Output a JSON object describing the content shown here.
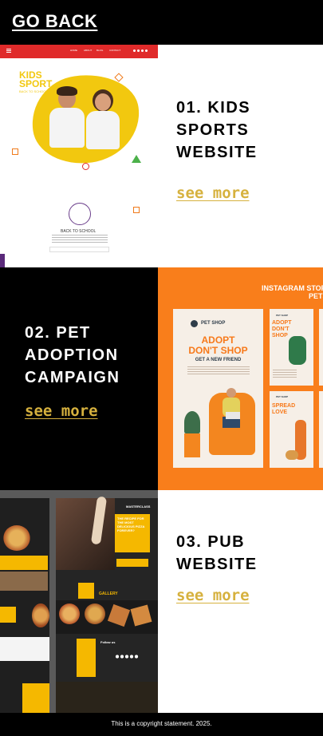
{
  "header": {
    "go_back_label": "GO BACK"
  },
  "projects": [
    {
      "title_line1": "01. KIDS",
      "title_line2": "SPORTS",
      "title_line3": "WEBSITE",
      "see_more_label": "see more",
      "thumbnail": {
        "logo_line1": "KIDS",
        "logo_line2": "SPORT",
        "tagline": "BACK TO SCHOOL",
        "nav_items": [
          "HOME",
          "ABOUT",
          "BLOG",
          "CONTACT"
        ],
        "back_to_school": "BACK TO SCHOOL"
      }
    },
    {
      "title_line1": "02. PET",
      "title_line2": "ADOPTION",
      "title_line3": "CAMPAIGN",
      "see_more_label": "see more",
      "thumbnail": {
        "banner": "INSTAGRAM STORIES",
        "banner2": "PETS",
        "brand": "PET SHOP",
        "headline_line1": "ADOPT",
        "headline_line2": "DON'T SHOP",
        "subhead": "GET A NEW FRIEND",
        "small_headline1": "ADOPT",
        "small_headline2": "DON'T",
        "small_headline3": "SHOP",
        "spread_line1": "SPREAD",
        "spread_line2": "LOVE"
      }
    },
    {
      "title_line1": "03. PUB",
      "title_line2": "WEBSITE",
      "see_more_label": "see more",
      "thumbnail": {
        "masterclass": "MASTERCLASS",
        "recipe_line1": "THE RECIPE FOR",
        "recipe_line2": "THE MOST",
        "recipe_line3": "DELICIOUS PIZZA",
        "recipe_line4": "FOREVER?",
        "gallery": "GALLERY",
        "follow": "Follow us"
      }
    }
  ],
  "footer": {
    "copyright": "This is a copyright statement. 2025."
  },
  "colors": {
    "gold": "#d6b13e",
    "orange": "#f97e1b",
    "red_nav": "#e02a2a",
    "kids_yellow": "#f2c80f",
    "pub_yellow": "#f5b800"
  },
  "icons": [
    "menu-icon",
    "heart-icon",
    "social-icons"
  ]
}
